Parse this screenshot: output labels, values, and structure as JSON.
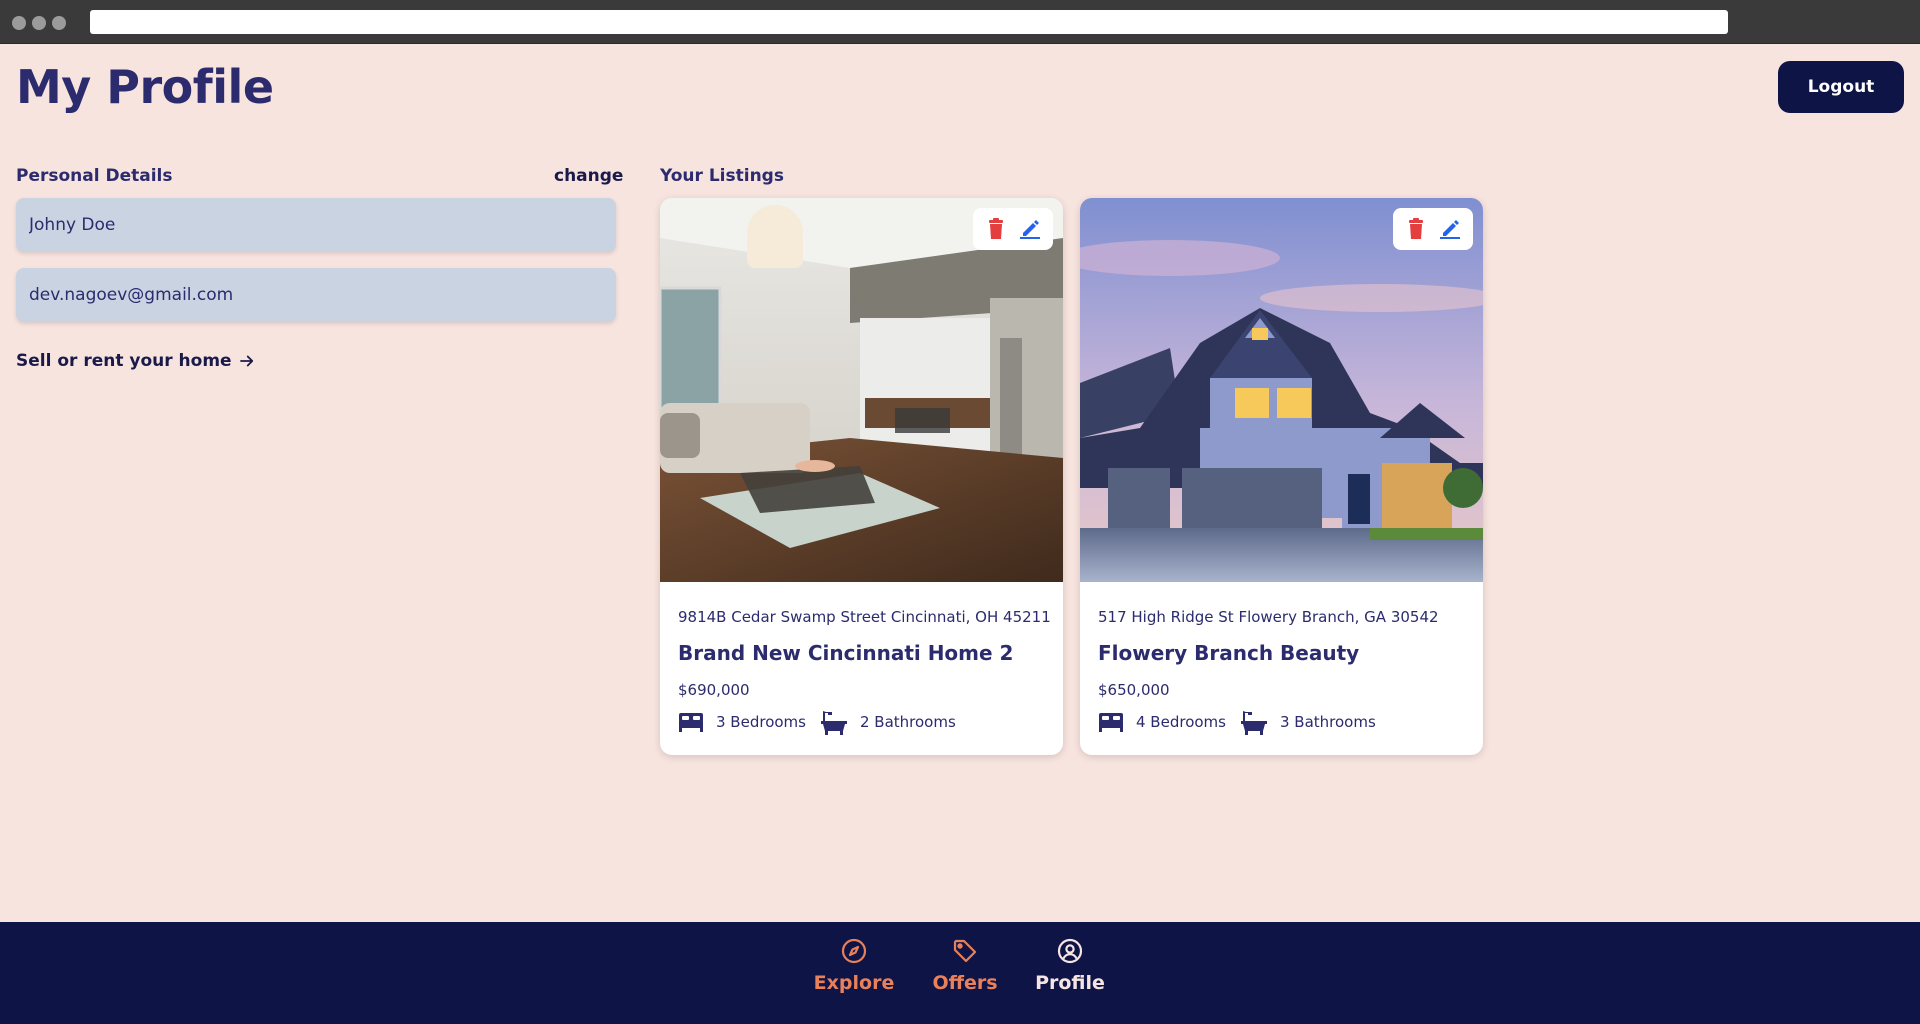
{
  "page": {
    "title": "My Profile",
    "logout_label": "Logout"
  },
  "personal_details": {
    "label": "Personal Details",
    "change_label": "change",
    "name_value": "Johny Doe",
    "email_value": "dev.nagoev@gmail.com",
    "sell_link": "Sell or rent your home"
  },
  "listings": {
    "label": "Your Listings",
    "items": [
      {
        "address": "9814B Cedar Swamp Street Cincinnati, OH 45211",
        "title": "Brand New Cincinnati Home 2",
        "price": "$690,000",
        "bedrooms": "3 Bedrooms",
        "bathrooms": "2 Bathrooms"
      },
      {
        "address": "517 High Ridge St Flowery Branch, GA 30542",
        "title": "Flowery Branch Beauty",
        "price": "$650,000",
        "bedrooms": "4 Bedrooms",
        "bathrooms": "3 Bathrooms"
      }
    ]
  },
  "nav": {
    "items": [
      {
        "label": "Explore",
        "icon": "compass-icon"
      },
      {
        "label": "Offers",
        "icon": "tag-icon"
      },
      {
        "label": "Profile",
        "icon": "user-circle-icon"
      }
    ]
  },
  "colors": {
    "accent": "#0f1447",
    "nav_inactive": "#e8805a",
    "delete": "#e53e3e",
    "edit": "#2563eb",
    "background": "#f8e4df"
  }
}
